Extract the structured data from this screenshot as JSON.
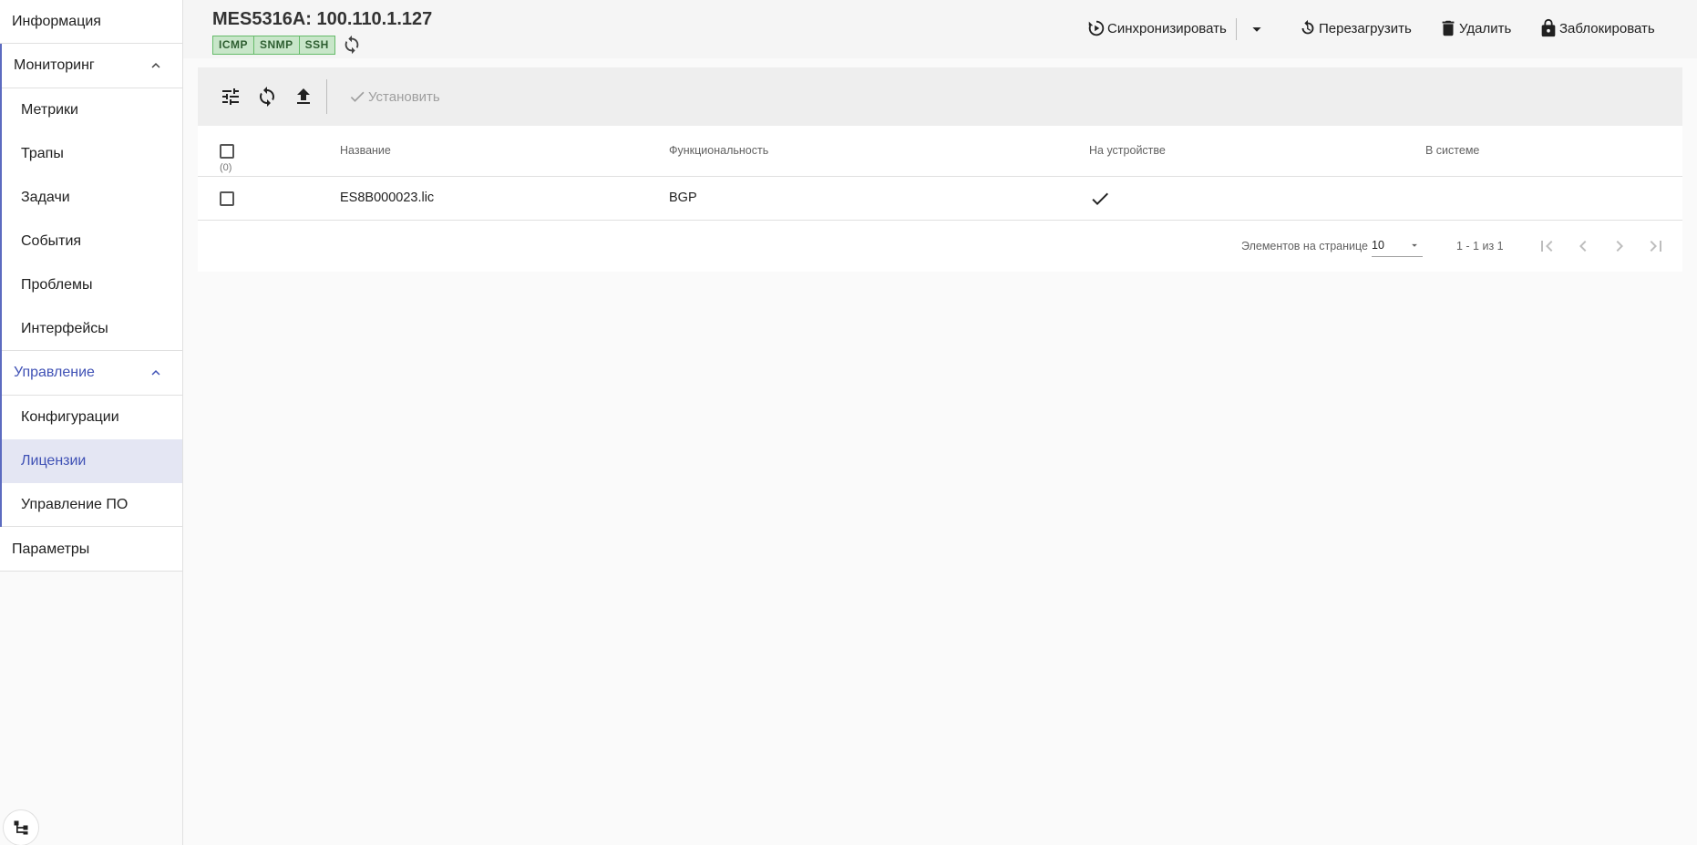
{
  "sidebar": {
    "info_label": "Информация",
    "monitoring": {
      "label": "Мониторинг",
      "items": [
        "Метрики",
        "Трапы",
        "Задачи",
        "События",
        "Проблемы",
        "Интерфейсы"
      ]
    },
    "management": {
      "label": "Управление",
      "items": [
        "Конфигурации",
        "Лицензии",
        "Управление ПО"
      ],
      "selected": "Лицензии"
    },
    "params_label": "Параметры"
  },
  "header": {
    "title": "MES5316A: 100.110.1.127",
    "badges": [
      "ICMP",
      "SNMP",
      "SSH"
    ],
    "actions": {
      "sync": "Синхронизировать",
      "reboot": "Перезагрузить",
      "delete": "Удалить",
      "lock": "Заблокировать"
    }
  },
  "toolbar": {
    "install_label": "Установить"
  },
  "table": {
    "columns": {
      "name": "Название",
      "functionality": "Функциональность",
      "on_device": "На устройстве",
      "in_system": "В системе"
    },
    "selected_count": "(0)",
    "rows": [
      {
        "name": "ES8B000023.lic",
        "functionality": "BGP",
        "on_device": true,
        "in_system": false
      }
    ]
  },
  "pagination": {
    "items_per_page_label": "Элементов на странице",
    "page_size": "10",
    "range": "1 - 1 из 1"
  },
  "colors": {
    "accent": "#3f51b5",
    "selected_bg": "#e4e6f3",
    "badge_bg": "#c8e6c9",
    "badge_border": "#66bb6a"
  }
}
